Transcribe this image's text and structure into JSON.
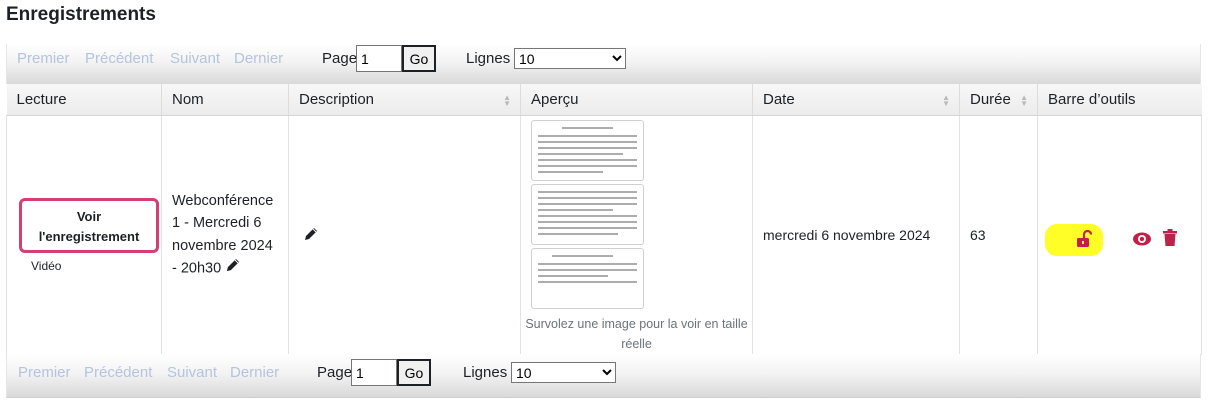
{
  "page": {
    "title": "Enregistrements"
  },
  "pager": {
    "first": "Premier",
    "previous": "Précédent",
    "next": "Suivant",
    "last": "Dernier",
    "page_label": "Page",
    "page_value": "1",
    "go": "Go",
    "rows_label": "Lignes",
    "rows_value": "10"
  },
  "table": {
    "headers": {
      "lecture": "Lecture",
      "nom": "Nom",
      "description": "Description",
      "apercu": "Aperçu",
      "date": "Date",
      "duree": "Durée",
      "outils": "Barre d’outils"
    },
    "rows": [
      {
        "play_button": "Voir l'enregistrement",
        "format": "Vidéo",
        "name": "Webconférence 1 - Mercredi 6 novembre 2024 - 20h30",
        "preview_hint": "Survolez une image pour la voir en taille réelle",
        "date": "mercredi 6 novembre 2024",
        "duration": "63"
      }
    ]
  },
  "icons": {
    "edit": "pencil-icon",
    "unlock": "unlock-icon",
    "visibility": "eye-icon",
    "delete": "trash-icon"
  },
  "colors": {
    "accent": "#c31f4b",
    "button_border": "#d23f72",
    "highlight": "#ffff27",
    "pager_disabled": "#b5c3de"
  }
}
